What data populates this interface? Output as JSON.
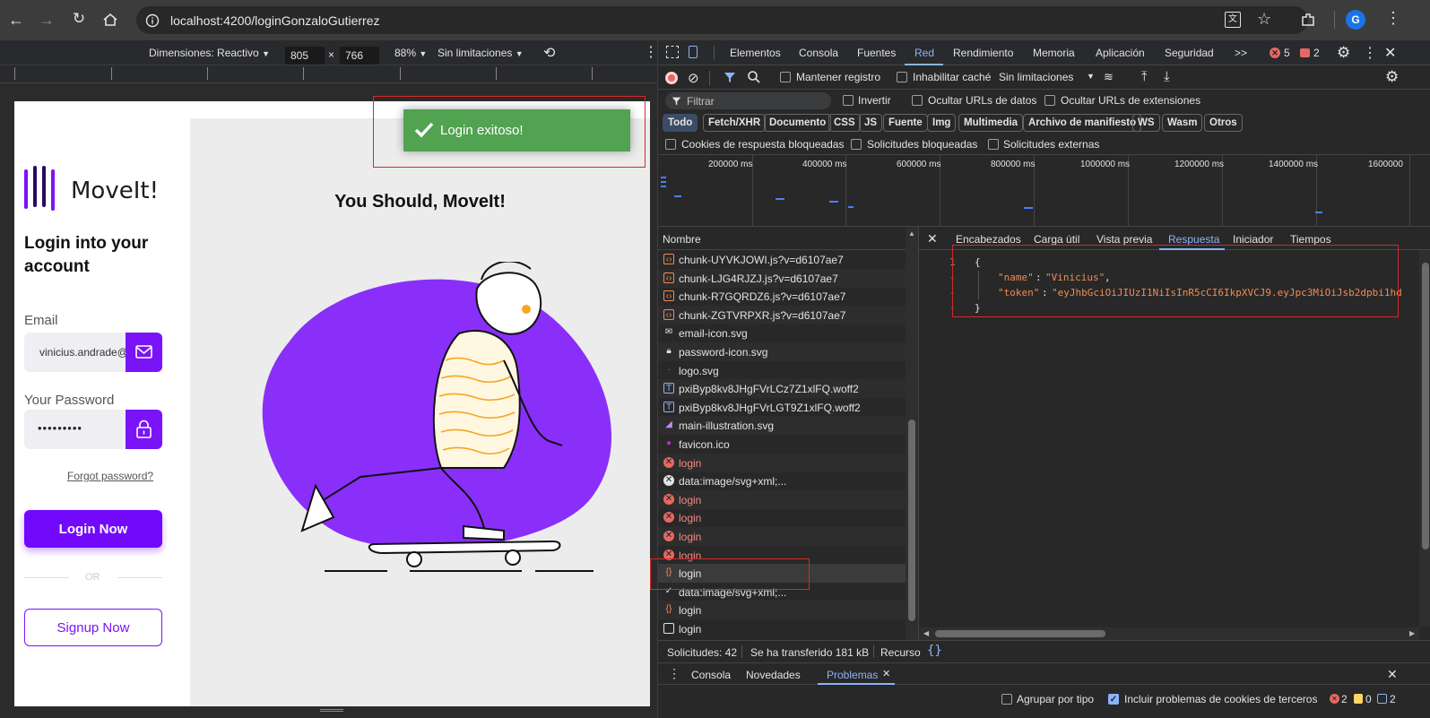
{
  "browser": {
    "url": "localhost:4200/loginGonzaloGutierrez",
    "profile_initial": "G"
  },
  "device_toolbar": {
    "dimensions_label": "Dimensiones: Reactivo",
    "width": "805",
    "height": "766",
    "times": "×",
    "zoom": "88%",
    "throttle": "Sin limitaciones"
  },
  "app": {
    "brand": "MoveIt!",
    "login_title_line1": "Login into your",
    "login_title_line2": "account",
    "email_label": "Email",
    "email_value": "vinicius.andrade@",
    "password_label": "Your Password",
    "password_value": "•••••••••",
    "forgot_link": "Forgot password?",
    "login_button": "Login Now",
    "or_divider": "OR",
    "signup_button": "Signup Now",
    "hero_title": "You Should, MoveIt!",
    "toast_message": "Login exitoso!",
    "accent_color": "#7b13f9"
  },
  "devtools": {
    "tabs": [
      "Elementos",
      "Consola",
      "Fuentes",
      "Red",
      "Rendimiento",
      "Memoria",
      "Aplicación",
      "Seguridad"
    ],
    "active_tab": "Red",
    "more_tabs": ">>",
    "error_count": "5",
    "warning_count": "2",
    "keep_log": "Mantener registro",
    "disable_cache": "Inhabilitar caché",
    "throttle": "Sin limitaciones",
    "filter_placeholder": "Filtrar",
    "invert": "Invertir",
    "hide_data_urls": "Ocultar URLs de datos",
    "hide_ext_urls": "Ocultar URLs de extensiones",
    "type_filters": [
      "Todo",
      "Fetch/XHR",
      "Documento",
      "CSS",
      "JS",
      "Fuente",
      "Img",
      "Multimedia",
      "Archivo de manifiesto",
      "WS",
      "Wasm",
      "Otros"
    ],
    "active_type": "Todo",
    "blocked_cookies": "Cookies de respuesta bloqueadas",
    "blocked_requests": "Solicitudes bloqueadas",
    "external_requests": "Solicitudes externas",
    "timeline_labels": [
      "200000 ms",
      "400000 ms",
      "600000 ms",
      "800000 ms",
      "1000000 ms",
      "1200000 ms",
      "1400000 ms",
      "1600000"
    ],
    "name_column": "Nombre",
    "requests": [
      {
        "name": "chunk-UYVKJOWI.js?v=d6107ae7",
        "kind": "script",
        "error": false
      },
      {
        "name": "chunk-LJG4RJZJ.js?v=d6107ae7",
        "kind": "script",
        "error": false
      },
      {
        "name": "chunk-R7GQRDZ6.js?v=d6107ae7",
        "kind": "script",
        "error": false
      },
      {
        "name": "chunk-ZGTVRPXR.js?v=d6107ae7",
        "kind": "script",
        "error": false
      },
      {
        "name": "email-icon.svg",
        "kind": "mail",
        "error": false
      },
      {
        "name": "password-icon.svg",
        "kind": "lock",
        "error": false
      },
      {
        "name": "logo.svg",
        "kind": "dot",
        "error": false
      },
      {
        "name": "pxiByp8kv8JHgFVrLCz7Z1xlFQ.woff2",
        "kind": "font",
        "error": false
      },
      {
        "name": "pxiByp8kv8JHgFVrLGT9Z1xlFQ.woff2",
        "kind": "font",
        "error": false
      },
      {
        "name": "main-illustration.svg",
        "kind": "image",
        "error": false
      },
      {
        "name": "favicon.ico",
        "kind": "favicon",
        "error": false
      },
      {
        "name": "login",
        "kind": "error",
        "error": true
      },
      {
        "name": "data:image/svg+xml;...",
        "kind": "close",
        "error": false
      },
      {
        "name": "login",
        "kind": "error",
        "error": true
      },
      {
        "name": "login",
        "kind": "error",
        "error": true
      },
      {
        "name": "login",
        "kind": "error",
        "error": true
      },
      {
        "name": "login",
        "kind": "error",
        "error": true
      },
      {
        "name": "login",
        "kind": "fetch",
        "error": false
      },
      {
        "name": "data:image/svg+xml;...",
        "kind": "check",
        "error": false
      },
      {
        "name": "login",
        "kind": "fetch",
        "error": false
      },
      {
        "name": "login",
        "kind": "doc",
        "error": false
      }
    ],
    "detail_tabs": [
      "Encabezados",
      "Carga útil",
      "Vista previa",
      "Respuesta",
      "Iniciador",
      "Tiempos"
    ],
    "active_detail_tab": "Respuesta",
    "response": {
      "line_number": "1",
      "open_brace": "{",
      "name_key": "\"name\"",
      "name_value": "\"Vinicius\"",
      "token_key": "\"token\"",
      "token_value": "\"eyJhbGciOiJIUzI1NiIsInR5cCI6IkpXVCJ9.eyJpc3MiOiJsb2dpbi1hd",
      "close_brace": "}"
    },
    "status": {
      "requests": "Solicitudes: 42",
      "transferred": "Se ha transferido 181 kB",
      "resources": "Recurso"
    },
    "drawer_tabs": [
      "Consola",
      "Novedades",
      "Problemas"
    ],
    "active_drawer_tab": "Problemas",
    "group_by_type": "Agrupar por tipo",
    "third_party": "Incluir problemas de cookies de terceros",
    "issue_counts": {
      "errors": "2",
      "warnings": "0",
      "info": "2"
    }
  }
}
